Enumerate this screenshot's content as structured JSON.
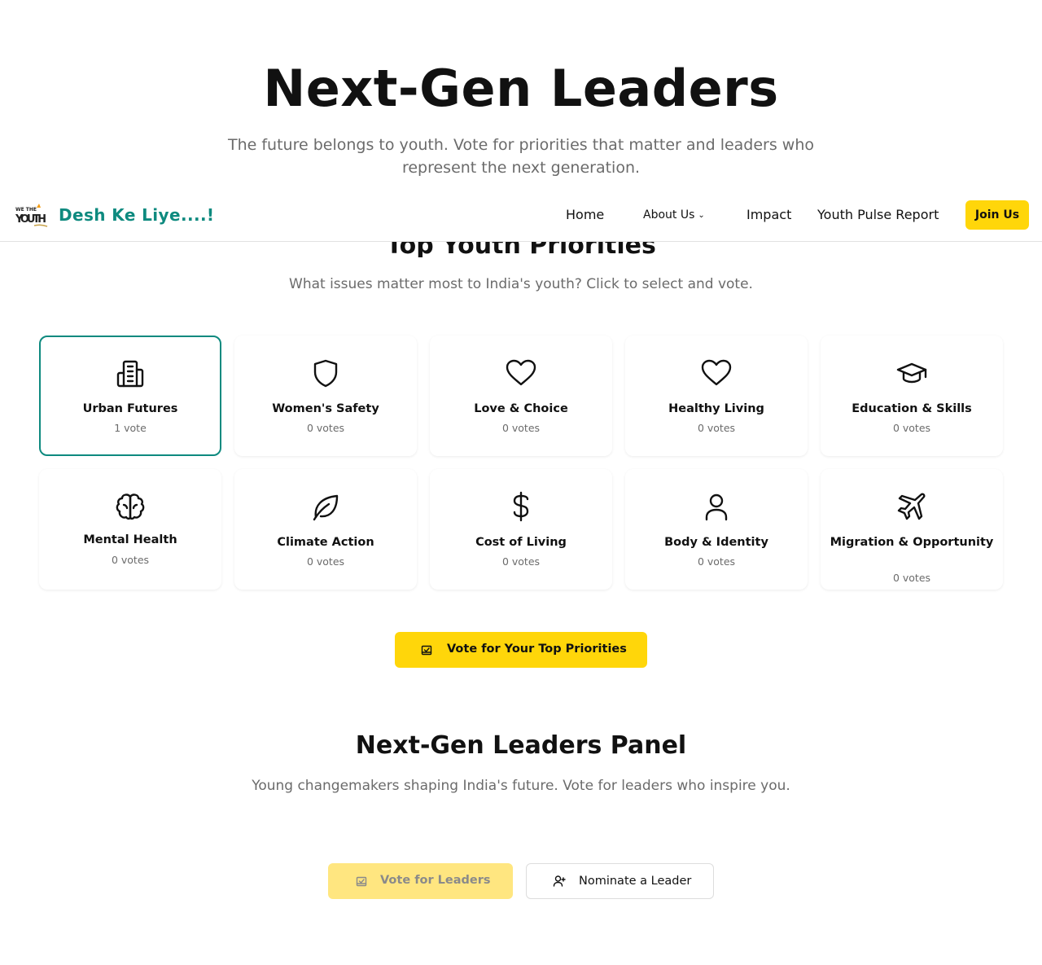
{
  "hero": {
    "title": "Next-Gen Leaders",
    "subtitle": "The future belongs to youth. Vote for priorities that matter and leaders who represent the next generation."
  },
  "nav": {
    "logo_text": "WE THE YOUTH",
    "brand": "Desh Ke Liye....!",
    "links": [
      "Home",
      "About Us",
      "Impact",
      "Youth Pulse Report"
    ],
    "join_label": "Join Us"
  },
  "priorities": {
    "title": "Top Youth Priorities",
    "subtitle": "What issues matter most to India's youth? Click to select and vote.",
    "items": [
      {
        "label": "Urban Futures",
        "votes": "1 vote",
        "icon": "building-icon",
        "selected": true
      },
      {
        "label": "Women's Safety",
        "votes": "0 votes",
        "icon": "shield-icon",
        "selected": false
      },
      {
        "label": "Love & Choice",
        "votes": "0 votes",
        "icon": "heart-icon",
        "selected": false
      },
      {
        "label": "Healthy Living",
        "votes": "0 votes",
        "icon": "heart-icon",
        "selected": false
      },
      {
        "label": "Education & Skills",
        "votes": "0 votes",
        "icon": "graduation-cap-icon",
        "selected": false
      },
      {
        "label": "Mental Health",
        "votes": "0 votes",
        "icon": "brain-icon",
        "selected": false
      },
      {
        "label": "Climate Action",
        "votes": "0 votes",
        "icon": "leaf-icon",
        "selected": false
      },
      {
        "label": "Cost of Living",
        "votes": "0 votes",
        "icon": "dollar-icon",
        "selected": false
      },
      {
        "label": "Body & Identity",
        "votes": "0 votes",
        "icon": "user-icon",
        "selected": false
      },
      {
        "label": "Migration & Opportunity",
        "votes": "0 votes",
        "icon": "plane-icon",
        "selected": false
      }
    ],
    "vote_button": "Vote for Your Top Priorities"
  },
  "leaders": {
    "title": "Next-Gen Leaders Panel",
    "subtitle": "Young changemakers shaping India's future. Vote for leaders who inspire you.",
    "vote_button": "Vote for Leaders",
    "nominate_button": "Nominate a Leader"
  },
  "colors": {
    "accent": "#0e8a7f",
    "yellow": "#ffd60a",
    "yellow_disabled": "#ffe680"
  }
}
